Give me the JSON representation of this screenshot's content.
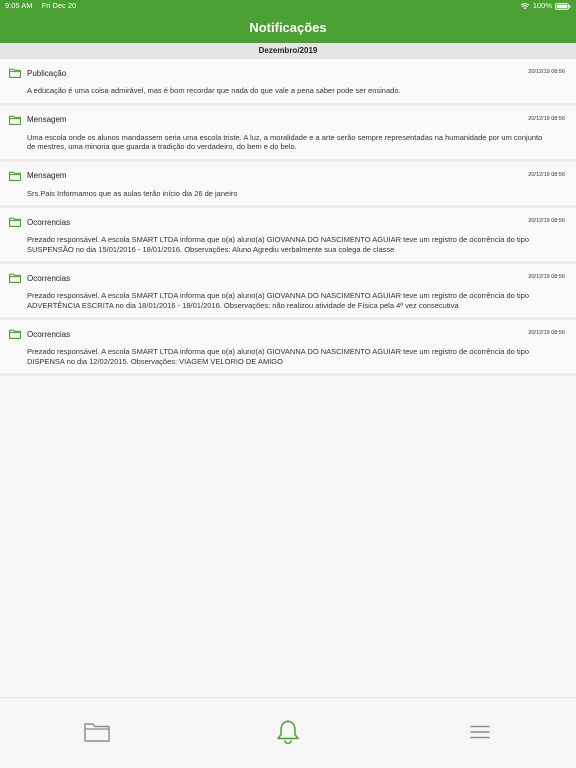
{
  "status_bar": {
    "time": "9:05 AM",
    "date": "Fri Dec 20",
    "battery": "100%",
    "icons": [
      "wifi-icon",
      "battery-icon"
    ]
  },
  "nav": {
    "title": "Notificações"
  },
  "section": {
    "title": "Dezembro/2019"
  },
  "notifications": [
    {
      "title": "Publicação",
      "date": "20/12/19 08:56",
      "body": "A educação é uma coisa admirável, mas é bom recordar que nada do que vale a pena saber pode ser ensinado."
    },
    {
      "title": "Mensagem",
      "date": "20/12/19 08:56",
      "body": "Uma escola onde os alunos mandassem seria uma escola triste. A luz, a moralidade e a arte serão sempre representadas na humanidade por um conjunto de mestres, uma minoria que guarda a tradição do verdadeiro, do bem e do belo."
    },
    {
      "title": "Mensagem",
      "date": "20/12/19 08:56",
      "body": "Srs.Pais Informamos que as aulas terão início dia 26 de janeiro"
    },
    {
      "title": "Ocorrencias",
      "date": "20/12/19 08:56",
      "body": "Prezado responsável. A escola SMART LTDA informa que o(a) aluno(a) GIOVANNA DO NASCIMENTO AGUIAR teve um registro de ocorrência do tipo SUSPENSÃO no dia 15/01/2016 - 18/01/2016. Observações: Aluno Agrediu verbalmente sua colega de classe"
    },
    {
      "title": "Ocorrencias",
      "date": "20/12/19 08:56",
      "body": "Prezado responsável. A escola SMART LTDA informa que o(a) aluno(a) GIOVANNA DO NASCIMENTO AGUIAR teve um registro de ocorrência do tipo ADVERTÊNCIA ESCRITA no dia 18/01/2016 - 18/01/2016. Observações: não realizou atividade de Física pela 4ª vez consecutiva"
    },
    {
      "title": "Ocorrencias",
      "date": "20/12/19 08:56",
      "body": "Prezado responsável. A escola SMART LTDA informa que o(a) aluno(a) GIOVANNA DO NASCIMENTO AGUIAR teve um registro de ocorrência do tipo DISPENSA no dia 12/02/2015. Observações: VIAGEM VELORIO DE AMIGO"
    }
  ],
  "tab_bar": {
    "tabs": [
      {
        "icon": "folder-icon",
        "active": false
      },
      {
        "icon": "bell-icon",
        "active": true
      },
      {
        "icon": "menu-icon",
        "active": false
      }
    ]
  },
  "colors": {
    "brand_green": "#4aa033",
    "section_bg": "#e4e4e4",
    "inactive_icon": "#8a8a8a"
  }
}
